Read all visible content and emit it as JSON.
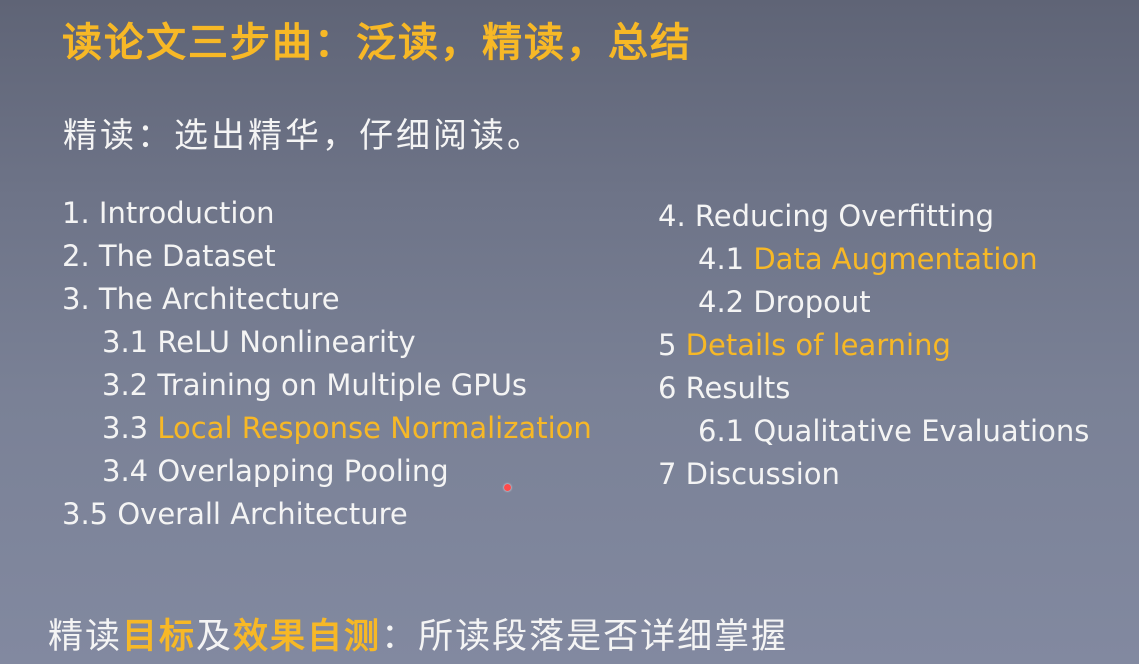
{
  "title": "读论文三步曲：泛读，精读，总结",
  "subtitle": "精读：选出精华，仔细阅读。",
  "toc_left": [
    {
      "num": "1.",
      "text": "Introduction"
    },
    {
      "num": "2.",
      "text": "The Dataset"
    },
    {
      "num": "3.",
      "text": "The Architecture"
    },
    {
      "num": "3.1",
      "text": "ReLU Nonlinearity"
    },
    {
      "num": "3.2",
      "text": "Training on Multiple GPUs"
    },
    {
      "num": "3.3",
      "text": "Local Response Normalization",
      "highlight": true
    },
    {
      "num": "3.4",
      "text": "Overlapping Pooling"
    },
    {
      "num": "3.5",
      "text": "Overall Architecture"
    }
  ],
  "toc_right": [
    {
      "num": "4.",
      "text": "Reducing Overfitting"
    },
    {
      "num": "4.1",
      "text": "Data Augmentation",
      "highlight": true
    },
    {
      "num": "4.2",
      "text": "Dropout"
    },
    {
      "num": "5",
      "text": "Details of learning",
      "highlight": true
    },
    {
      "num": "6",
      "text": "Results"
    },
    {
      "num": "6.1",
      "text": "Qualitative Evaluations"
    },
    {
      "num": "7",
      "text": "Discussion"
    }
  ],
  "footer": {
    "part1": "精读",
    "part2": "目标",
    "part3": "及",
    "part4": "效果自测",
    "part5": "：所读段落是否详细掌握"
  },
  "colors": {
    "highlight": "#f7b826",
    "text": "#f4f4f4",
    "pointer": "#ff4a4a"
  }
}
